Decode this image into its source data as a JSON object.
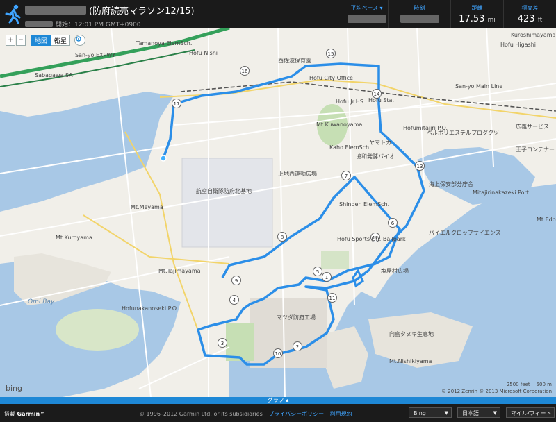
{
  "header": {
    "title": "(防府読売マラソン12/15)",
    "start_label": "開始：12:01 PM GMT+0900"
  },
  "stats": [
    {
      "label": "平均ペース ▾",
      "value": ""
    },
    {
      "label": "時刻",
      "value": ""
    },
    {
      "label": "距離",
      "value": "17.53",
      "unit": "mi"
    },
    {
      "label": "標高差",
      "value": "423",
      "unit": "ft"
    }
  ],
  "map_controls": {
    "zoom_in": "+",
    "zoom_out": "−",
    "map_tab": "地図",
    "satellite_tab": "衛星"
  },
  "map_labels": [
    "Hofu Nishi",
    "Sabagawa SA",
    "San-yo EXPWY",
    "Tamanoya ElemSch.",
    "西佐波保育園",
    "Hofu City Office",
    "Hofu Jr.HS.",
    "Hofu Sports Ctr. Ballpark",
    "Mt.Kuwanoyama",
    "Kaho ElemSch.",
    "協和発酵バイオ",
    "ヤマトカ",
    "Shinden ElemSch.",
    "上地西運動広場",
    "航空自衛隊防府北基地",
    "Mt.Meyama",
    "Mt.Kuroyama",
    "Mt.Tajimayama",
    "Omi Bay",
    "Hofunakanoseki P.O.",
    "マツダ防府工場",
    "Mitajirinakazeki Port",
    "Mt.Nishikiyama",
    "向島タヌキ生息地",
    "塩屋村広場",
    "Hofu Sta.",
    "San-yo Main Line",
    "ベルポリエステルプロダクツ",
    "海上保安部分庁舎",
    "パイエルクロップサイエンス",
    "王子コンテナー",
    "広義サービス",
    "Hofumitajiri P.O.",
    "Hofu Higashi",
    "Mt.Edon",
    "Kuroshimayama Reservoir"
  ],
  "markers": [
    "1",
    "2",
    "3",
    "4",
    "5",
    "6",
    "7",
    "8",
    "9",
    "10",
    "11",
    "12",
    "13",
    "14",
    "15",
    "16",
    "17"
  ],
  "route_color": "#2b8ee8",
  "attribution": {
    "bing": "bing",
    "copyright": "© 2012 Zenrin   © 2013 Microsoft Corporation",
    "scale_ft": "2500 feet",
    "scale_m": "500 m"
  },
  "graph_toggle": "グラフ ▴",
  "footer": {
    "brand_prefix": "搭載",
    "brand": "Garmin™",
    "copyright": "© 1996–2012 Garmin Ltd. or its subsidiaries",
    "privacy": "プライバシーポリシー",
    "terms": "利用規約",
    "map_provider": "Bing",
    "language": "日本語",
    "units": "マイル/フィート"
  }
}
